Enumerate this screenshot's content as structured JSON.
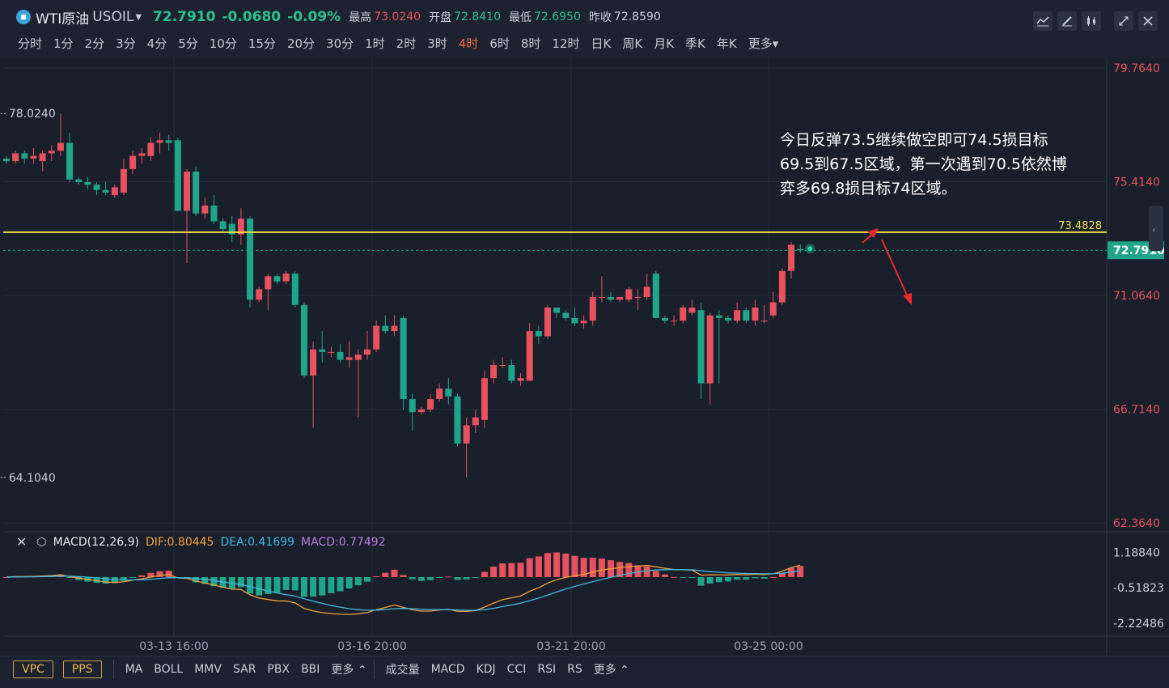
{
  "header": {
    "name": "WTI原油",
    "code": "USOIL",
    "price": "72.7910",
    "change": "-0.0680",
    "change_pct": "-0.09%",
    "high_label": "最高",
    "high": "73.0240",
    "open_label": "开盘",
    "open": "72.8410",
    "low_label": "最低",
    "low": "72.6950",
    "prev_label": "昨收",
    "prev": "72.8590"
  },
  "toolbar_icons": [
    "chart-style-icon",
    "draw-icon",
    "candles-icon",
    "shrink-icon",
    "close-icon"
  ],
  "periods": [
    {
      "label": "分时",
      "active": false
    },
    {
      "label": "1分",
      "active": false
    },
    {
      "label": "2分",
      "active": false
    },
    {
      "label": "3分",
      "active": false
    },
    {
      "label": "4分",
      "active": false
    },
    {
      "label": "5分",
      "active": false
    },
    {
      "label": "10分",
      "active": false
    },
    {
      "label": "15分",
      "active": false
    },
    {
      "label": "20分",
      "active": false
    },
    {
      "label": "30分",
      "active": false
    },
    {
      "label": "1时",
      "active": false
    },
    {
      "label": "2时",
      "active": false
    },
    {
      "label": "3时",
      "active": false
    },
    {
      "label": "4时",
      "active": true
    },
    {
      "label": "6时",
      "active": false
    },
    {
      "label": "8时",
      "active": false
    },
    {
      "label": "12时",
      "active": false
    },
    {
      "label": "日K",
      "active": false
    },
    {
      "label": "周K",
      "active": false
    },
    {
      "label": "月K",
      "active": false
    },
    {
      "label": "季K",
      "active": false
    },
    {
      "label": "年K",
      "active": false
    },
    {
      "label": "更多",
      "active": false
    }
  ],
  "annotation_lines": [
    "今日反弹73.5继续做空即可74.5损目标",
    "69.5到67.5区域，第一次遇到70.5依然博",
    "弈多69.8损目标74区域。"
  ],
  "colors": {
    "up": "#e8515e",
    "down": "#1fa68a",
    "hline": "#f0e14a",
    "accent": "#f26b3a",
    "dif": "#f5a03a",
    "dea": "#3fb8e0"
  },
  "chart_data": {
    "type": "candlestick",
    "y_axis_ticks": [
      "79.7640",
      "75.4140",
      "71.0640",
      "66.7140",
      "62.3640"
    ],
    "ylim": [
      62.364,
      79.764
    ],
    "x_axis_labels": [
      "03-13 16:00",
      "03-16 20:00",
      "03-21 20:00",
      "03-25 00:00"
    ],
    "horizontal_line": {
      "label": "73.4828",
      "value": 73.4828
    },
    "current_price_tag": {
      "label": "72.7910",
      "value": 72.791
    },
    "max_marker": {
      "label": "78.0240",
      "value": 78.024
    },
    "min_marker": {
      "label": "64.1040",
      "value": 64.104
    },
    "candles": [
      [
        76.3,
        76.4,
        76.1,
        76.2
      ],
      [
        76.2,
        76.6,
        76.1,
        76.5
      ],
      [
        76.5,
        76.6,
        76.1,
        76.3
      ],
      [
        76.3,
        76.7,
        76.1,
        76.4
      ],
      [
        76.2,
        76.6,
        75.8,
        76.5
      ],
      [
        76.5,
        76.8,
        76.2,
        76.6
      ],
      [
        76.6,
        78.02,
        76.4,
        76.9
      ],
      [
        76.9,
        77.3,
        75.4,
        75.5
      ],
      [
        75.5,
        75.6,
        75.3,
        75.4
      ],
      [
        75.4,
        75.6,
        75.1,
        75.3
      ],
      [
        75.3,
        75.4,
        74.9,
        75.1
      ],
      [
        75.1,
        75.4,
        74.9,
        75.0
      ],
      [
        74.9,
        75.3,
        74.8,
        75.2
      ],
      [
        75.0,
        76.3,
        74.9,
        75.9
      ],
      [
        75.9,
        76.6,
        75.7,
        76.4
      ],
      [
        76.4,
        76.7,
        76.1,
        76.5
      ],
      [
        76.4,
        77.1,
        76.2,
        76.9
      ],
      [
        76.9,
        77.3,
        76.5,
        77.0
      ],
      [
        77.0,
        77.2,
        76.6,
        76.9
      ],
      [
        77.0,
        77.1,
        74.3,
        74.3
      ],
      [
        74.3,
        75.9,
        72.3,
        75.8
      ],
      [
        75.8,
        76.0,
        74.1,
        74.2
      ],
      [
        74.2,
        74.8,
        74.0,
        74.5
      ],
      [
        74.5,
        74.9,
        73.8,
        73.9
      ],
      [
        73.9,
        74.0,
        73.5,
        73.6
      ],
      [
        73.8,
        74.1,
        73.1,
        73.4
      ],
      [
        73.4,
        74.4,
        73.0,
        74.0
      ],
      [
        74.0,
        74.1,
        70.6,
        70.9
      ],
      [
        70.9,
        71.4,
        70.8,
        71.3
      ],
      [
        71.3,
        71.9,
        70.5,
        71.8
      ],
      [
        71.8,
        71.9,
        71.5,
        71.6
      ],
      [
        71.6,
        72.0,
        71.5,
        71.9
      ],
      [
        71.9,
        72.0,
        70.6,
        70.7
      ],
      [
        70.7,
        70.8,
        67.9,
        68.0
      ],
      [
        68.0,
        69.3,
        66.0,
        69.0
      ],
      [
        69.0,
        69.7,
        68.5,
        68.9
      ],
      [
        68.9,
        69.1,
        68.7,
        68.9
      ],
      [
        68.9,
        69.2,
        68.5,
        68.6
      ],
      [
        68.6,
        69.3,
        68.3,
        68.7
      ],
      [
        68.6,
        69.0,
        66.4,
        68.8
      ],
      [
        68.8,
        69.7,
        68.6,
        69.0
      ],
      [
        69.0,
        70.1,
        68.9,
        69.9
      ],
      [
        69.9,
        70.3,
        69.6,
        69.7
      ],
      [
        69.7,
        70.3,
        69.5,
        69.9
      ],
      [
        70.2,
        70.3,
        66.7,
        67.1
      ],
      [
        67.1,
        67.3,
        65.9,
        66.6
      ],
      [
        66.6,
        66.8,
        66.5,
        66.7
      ],
      [
        66.7,
        67.3,
        66.6,
        67.1
      ],
      [
        67.1,
        67.7,
        67.0,
        67.5
      ],
      [
        67.5,
        67.9,
        66.9,
        67.2
      ],
      [
        67.2,
        67.3,
        65.3,
        65.4
      ],
      [
        65.4,
        66.4,
        64.1,
        66.1
      ],
      [
        66.1,
        66.7,
        65.8,
        66.4
      ],
      [
        66.3,
        68.2,
        66.0,
        67.9
      ],
      [
        67.9,
        68.6,
        67.7,
        68.4
      ],
      [
        68.4,
        68.7,
        68.3,
        68.4
      ],
      [
        68.4,
        68.6,
        67.7,
        67.8
      ],
      [
        67.8,
        68.1,
        67.6,
        67.9
      ],
      [
        67.8,
        70.0,
        67.8,
        69.7
      ],
      [
        69.7,
        69.9,
        69.2,
        69.5
      ],
      [
        69.5,
        70.7,
        69.4,
        70.6
      ],
      [
        70.6,
        70.6,
        70.2,
        70.4
      ],
      [
        70.4,
        70.5,
        70.1,
        70.2
      ],
      [
        70.2,
        70.6,
        69.9,
        70.0
      ],
      [
        70.0,
        70.3,
        69.8,
        70.1
      ],
      [
        70.1,
        71.2,
        69.9,
        71.0
      ],
      [
        71.0,
        71.8,
        70.8,
        71.0
      ],
      [
        71.0,
        71.2,
        70.8,
        70.9
      ],
      [
        70.9,
        71.0,
        70.8,
        71.0
      ],
      [
        70.9,
        71.4,
        70.8,
        71.3
      ],
      [
        71.0,
        71.3,
        70.5,
        71.0
      ],
      [
        71.0,
        71.9,
        70.9,
        71.4
      ],
      [
        71.9,
        72.0,
        70.2,
        70.2
      ],
      [
        70.2,
        70.3,
        70.0,
        70.1
      ],
      [
        70.1,
        70.3,
        69.9,
        70.1
      ],
      [
        70.1,
        70.7,
        70.0,
        70.6
      ],
      [
        70.4,
        70.9,
        70.3,
        70.6
      ],
      [
        70.5,
        70.8,
        67.1,
        67.7
      ],
      [
        67.7,
        70.4,
        66.9,
        70.3
      ],
      [
        70.3,
        70.5,
        67.7,
        70.2
      ],
      [
        70.2,
        70.3,
        70.0,
        70.1
      ],
      [
        70.1,
        70.8,
        70.0,
        70.5
      ],
      [
        70.5,
        70.6,
        70.0,
        70.1
      ],
      [
        70.1,
        70.9,
        69.9,
        70.6
      ],
      [
        70.1,
        70.7,
        70.0,
        70.1
      ],
      [
        70.3,
        71.2,
        70.2,
        70.8
      ],
      [
        70.8,
        72.1,
        70.7,
        72.0
      ],
      [
        72.0,
        73.1,
        71.7,
        73.0
      ],
      [
        72.84,
        73.02,
        72.7,
        72.79
      ]
    ],
    "macd": {
      "label": "MACD(12,26,9)",
      "dif_label": "DIF:0.80445",
      "dea_label": "DEA:0.41699",
      "macd_label": "MACD:0.77492",
      "y_axis_ticks": [
        "1.18840",
        "-0.51823",
        "-2.22486"
      ],
      "ylim": [
        -2.5,
        1.6
      ]
    }
  },
  "bottom": {
    "pills": [
      "VPC",
      "PPS"
    ],
    "main_indicators": [
      "MA",
      "BOLL",
      "MMV",
      "SAR",
      "PBX",
      "BBI",
      "更多"
    ],
    "sub_indicators": [
      "成交量",
      "MACD",
      "KDJ",
      "CCI",
      "RSI",
      "RS",
      "更多"
    ]
  }
}
